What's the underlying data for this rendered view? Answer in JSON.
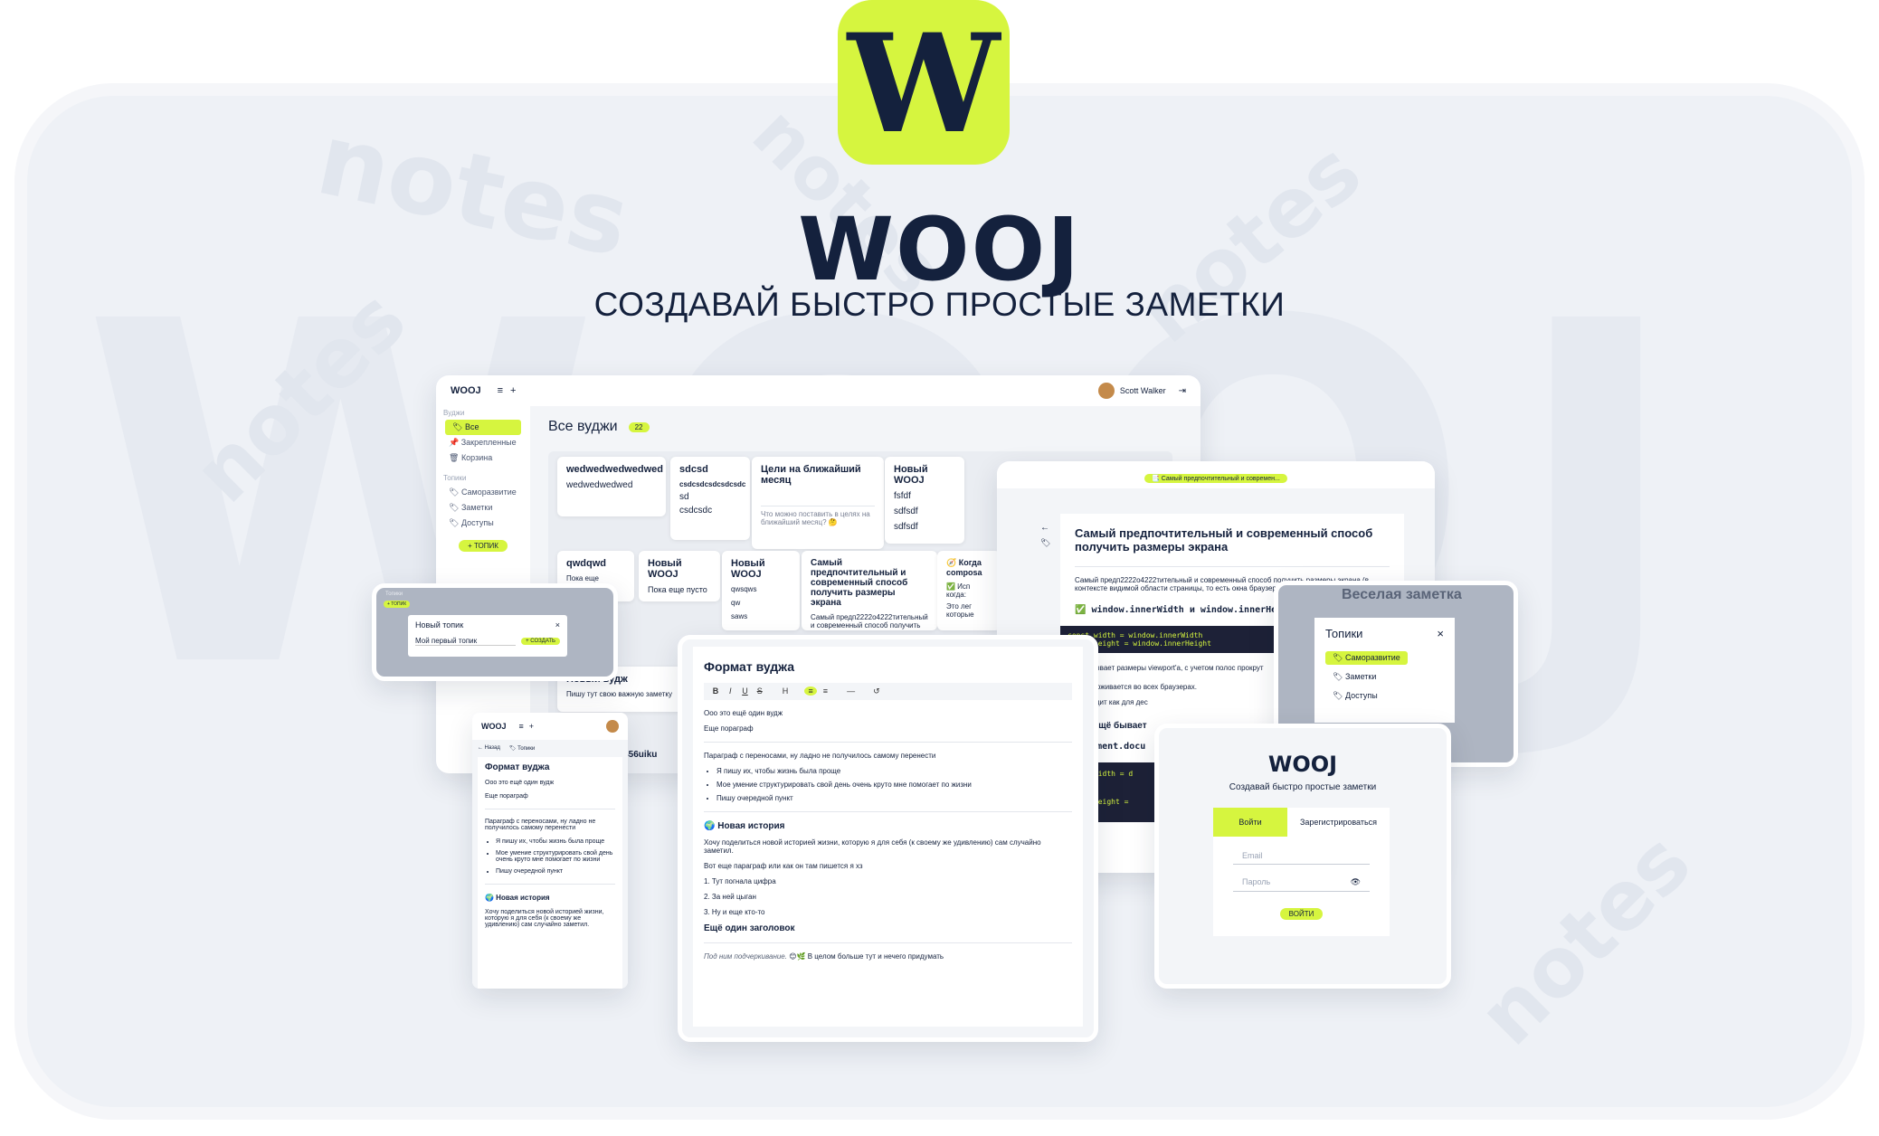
{
  "watermarks": [
    "notes",
    "notes",
    "notes",
    "notes",
    "notes",
    "WOOJ"
  ],
  "logo_letter": "W",
  "brand": "WOOJ",
  "tagline": "СОЗДАВАЙ БЫСТРО ПРОСТЫЕ ЗАМЕТКИ",
  "colors": {
    "accent": "#d6f53f",
    "navy": "#14213d",
    "bg": "#eef1f6"
  },
  "desktop": {
    "app_name": "WOOJ",
    "user": "Scott Walker",
    "sidebar": {
      "section1": "Вуджи",
      "items": [
        "Все",
        "Закрепленные",
        "Корзина"
      ],
      "section2": "Топики",
      "topics": [
        "Саморазвитие",
        "Заметки",
        "Доступы"
      ],
      "add_topic": "+ ТОПИК"
    },
    "heading": "Все вуджи",
    "count": "22",
    "cards": [
      {
        "title": "wedwedwedwedwed",
        "lines": [
          "wedwedwedwed"
        ]
      },
      {
        "title": "sdcsd",
        "lines": [
          "csdcsdcsdcsdcsdc",
          "sd",
          "csdcsdc"
        ]
      },
      {
        "title": "Цели на ближайший месяц",
        "lines": [
          "Что можно поставить в целях на ближайший месяц? 🤔"
        ]
      },
      {
        "title": "Новый WOOJ",
        "lines": [
          "fsfdf",
          "sdfsdf",
          "sdfsdf"
        ]
      },
      {
        "title": "qwdqwd",
        "lines": [
          "Пока еще пусто..."
        ]
      },
      {
        "title": "Новый WOOJ",
        "lines": [
          "Пока еще пусто"
        ]
      },
      {
        "title": "Новый WOOJ",
        "lines": [
          "qwsqws",
          "qw",
          "saws"
        ]
      },
      {
        "title": "Самый предпочтительный и современный способ получить размеры экрана",
        "lines": [
          "Самый предп2222о4222тительный и современный способ получить размеры экрана (в контексте"
        ]
      },
      {
        "title": "🧭 Когда composa",
        "lines": [
          "✅ Исп когда:",
          "Это лег которые"
        ]
      },
      {
        "title": "Новый вудж",
        "lines": [
          "Пишу тут свою важную заметку"
        ]
      }
    ],
    "footer_id": "56456uiku"
  },
  "topic_modal": {
    "title": "Новый топик",
    "value": "Мой первый топик",
    "submit": "+ СОЗДАТЬ",
    "topics_label": "Топики",
    "add": "+ ТОПИК"
  },
  "article": {
    "badge": "📑 Самый предпочтительный и современ...",
    "title": "Самый предпочтительный и современный способ получить размеры экрана",
    "intro": "Самый предп2222о4222тительный и современный способ получить размеры экрана (в контексте видимой области страницы, то есть окна браузера",
    "check": "✅ window.innerWidth и window.innerHeight",
    "code1": [
      "const width = window.innerWidth",
      "const height = window.innerHeight"
    ],
    "p2": "Показывает размеры viewport'а, с учетом полос прокрут",
    "p3": "Поддерживается во всех браузерах.",
    "p4": "Подходит как для дес",
    "h2": "Что ещё бывает",
    "code_inline": "document.docu",
    "code2": [
      "const width = d",
      "const height = "
    ]
  },
  "topics_popup": {
    "bg_title": "Веселая заметка",
    "title": "Топики",
    "items": [
      "Саморазвитие",
      "Заметки",
      "Доступы"
    ]
  },
  "editor": {
    "title": "Формат вуджа",
    "toolbar": [
      "B",
      "I",
      "U",
      "S",
      "H",
      "≡",
      "≡",
      "—",
      "↺"
    ],
    "p1": "Ооо это ещё один вудж",
    "p2": "Еще пораграф",
    "p3": "Параграф с переносами, ну ладно не получилось самому перенести",
    "bullets": [
      "Я пишу их, чтобы жизнь была проще",
      "Мое умение структурировать свой день очень круто мне помогает по жизни",
      "Пишу очередной пункт"
    ],
    "h1": "🌍 Новая история",
    "p4": "Хочу поделиться новой историей жизни, которую я для себя (к своему же удивлению) сам случайно заметил.",
    "p5": "Вот еще параграф или как он там пишется я хз",
    "numbered": [
      "1. Тут погнала цифра",
      "2. За ней цыган",
      "3. Ну и еще кто-то"
    ],
    "h2": "Ещё один заголовок",
    "p6a": "Под ним подчеркивание.",
    "p6b": " 😊🌿 В целом больше тут и нечего придумать"
  },
  "mobile": {
    "app_name": "WOOJ",
    "back": "← Назад",
    "topic": "🏷 Топики",
    "title": "Формат вуджа",
    "p1": "Ооо это ещё один вудж",
    "p2": "Еще пораграф",
    "p3": "Параграф с переносами, ну ладно не получилось самому перенести",
    "bullets": [
      "Я пишу их, чтобы жизнь была проще",
      "Мое умение структурировать свой день очень круто мне помогает по жизни",
      "Пишу очередной пункт"
    ],
    "h1": "🌍 Новая история",
    "p4": "Хочу поделиться новой историей жизни, которую я для себя (к своему же удивлению) сам случайно заметил."
  },
  "login": {
    "brand": "WOOJ",
    "subtitle": "Создавай быстро простые заметки",
    "tab_login": "Войти",
    "tab_register": "Зарегистрироваться",
    "email_placeholder": "Email",
    "password_placeholder": "Пароль",
    "submit": "ВОЙТИ"
  }
}
